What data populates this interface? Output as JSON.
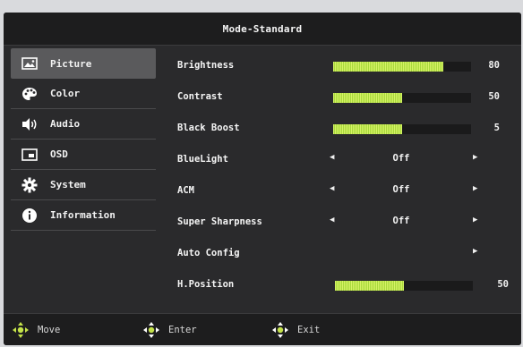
{
  "header": {
    "title": "Mode-Standard"
  },
  "sidebar": {
    "items": [
      {
        "label": "Picture",
        "icon": "picture-icon",
        "active": true
      },
      {
        "label": "Color",
        "icon": "palette-icon"
      },
      {
        "label": "Audio",
        "icon": "speaker-icon"
      },
      {
        "label": "OSD",
        "icon": "osd-icon"
      },
      {
        "label": "System",
        "icon": "gear-icon"
      },
      {
        "label": "Information",
        "icon": "info-icon"
      }
    ]
  },
  "main": {
    "brightness": {
      "label": "Brightness",
      "value": "80",
      "percent": 80
    },
    "contrast": {
      "label": "Contrast",
      "value": "50",
      "percent": 50
    },
    "black_boost": {
      "label": "Black Boost",
      "value": "5",
      "percent": 50
    },
    "blue_light": {
      "label": "BlueLight",
      "value": "Off"
    },
    "acm": {
      "label": "ACM",
      "value": "Off"
    },
    "super_sharpness": {
      "label": "Super Sharpness",
      "value": "Off"
    },
    "auto_config": {
      "label": "Auto Config"
    },
    "h_position": {
      "label": "H.Position",
      "value": "50",
      "percent": 50
    }
  },
  "footer": {
    "move": "Move",
    "enter": "Enter",
    "exit": "Exit"
  },
  "colors": {
    "accent": "#b5e03f",
    "panel": "#2a2a2c",
    "active": "#5a5a5c"
  }
}
